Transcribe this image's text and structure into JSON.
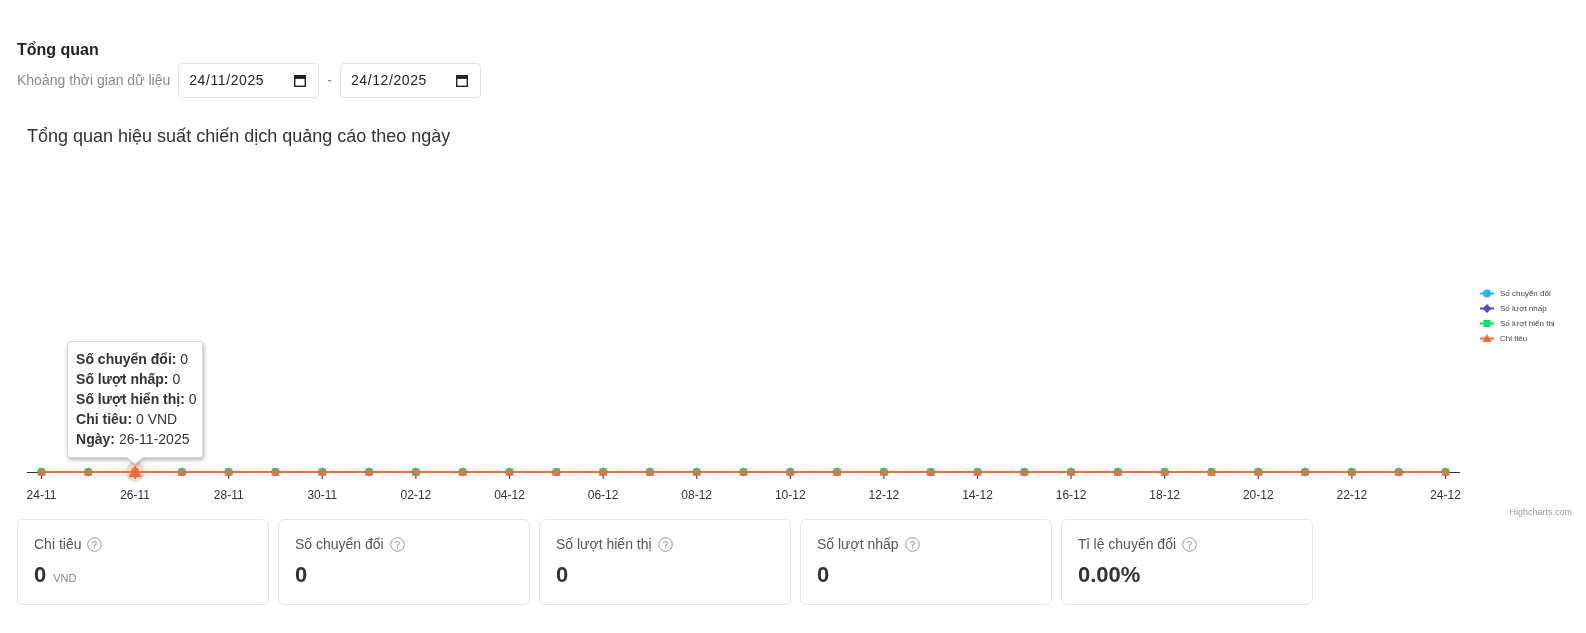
{
  "header": {
    "title": "Tổng quan",
    "date_range": {
      "label": "Khoảng thời gian dữ liệu",
      "start": {
        "value": "24/11/2025"
      },
      "separator": "-",
      "end": {
        "value": "24/12/2025"
      }
    }
  },
  "chart": {
    "title": "Tổng quan hiệu suất chiến dịch quảng cáo theo ngày",
    "credit": "Highcharts.com",
    "legend": [
      {
        "name": "Số chuyển đổi",
        "color": "#2caffe",
        "kind": "circle"
      },
      {
        "name": "Số lượt nhấp",
        "color": "#544fc5",
        "kind": "diamond"
      },
      {
        "name": "Số lượt hiển thị",
        "color": "#00e272",
        "kind": "square"
      },
      {
        "name": "Chi tiêu",
        "color": "#fe6a35",
        "kind": "triangle"
      }
    ],
    "x_axis_labels": [
      "24-11",
      "26-11",
      "28-11",
      "30-11",
      "02-12",
      "04-12",
      "06-12",
      "08-12",
      "10-12",
      "12-12",
      "14-12",
      "16-12",
      "18-12",
      "20-12",
      "22-12",
      "24-12"
    ],
    "points": [
      {
        "hovered": false
      },
      {
        "hovered": false
      },
      {
        "hovered": true
      },
      {
        "hovered": false
      },
      {
        "hovered": false
      },
      {
        "hovered": false
      },
      {
        "hovered": false
      },
      {
        "hovered": false
      },
      {
        "hovered": false
      },
      {
        "hovered": false
      },
      {
        "hovered": false
      },
      {
        "hovered": false
      },
      {
        "hovered": false
      },
      {
        "hovered": false
      },
      {
        "hovered": false
      },
      {
        "hovered": false
      },
      {
        "hovered": false
      },
      {
        "hovered": false
      },
      {
        "hovered": false
      },
      {
        "hovered": false
      },
      {
        "hovered": false
      },
      {
        "hovered": false
      },
      {
        "hovered": false
      },
      {
        "hovered": false
      },
      {
        "hovered": false
      },
      {
        "hovered": false
      },
      {
        "hovered": false
      },
      {
        "hovered": false
      },
      {
        "hovered": false
      },
      {
        "hovered": false
      },
      {
        "hovered": false
      }
    ],
    "tooltip": {
      "lines": [
        "**Số chuyển đổi:** 0",
        "**Số lượt nhấp:** 0",
        "**Số lượt hiển thị:** 0",
        "**Chi tiêu:** 0 VND",
        "**Ngày:** 26-11-2025"
      ]
    }
  },
  "cards": [
    {
      "label": "Chi tiêu",
      "value": "0",
      "unit": "VND"
    },
    {
      "label": "Số chuyển đổi",
      "value": "0"
    },
    {
      "label": "Số lượt hiển thị",
      "value": "0"
    },
    {
      "label": "Số lượt nhấp",
      "value": "0"
    },
    {
      "label": "Tỉ lệ chuyển đổi",
      "value": "0.00%"
    }
  ]
}
